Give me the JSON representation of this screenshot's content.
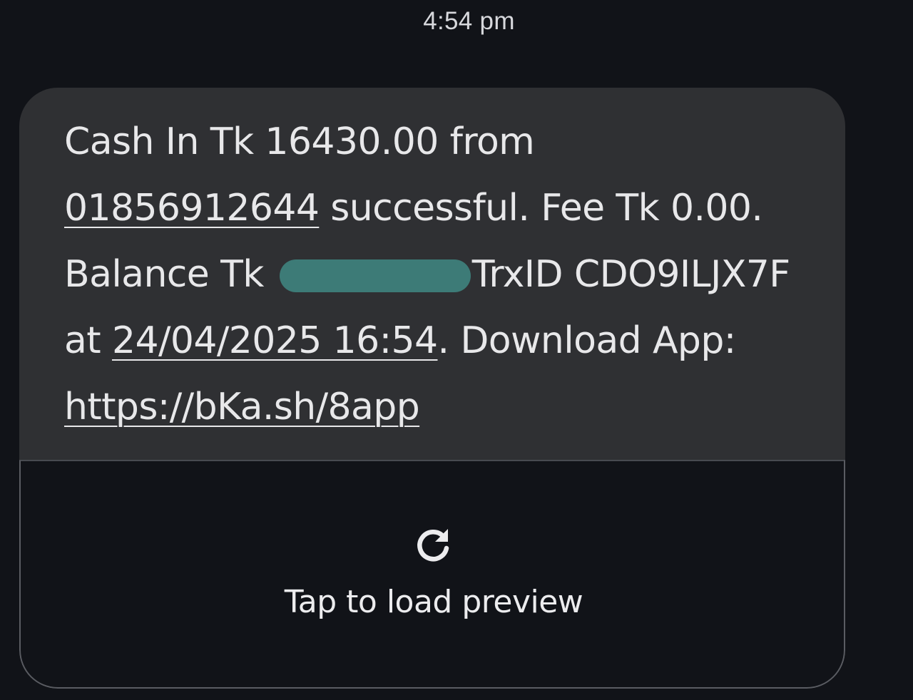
{
  "header": {
    "timestamp": "4:54 pm"
  },
  "message": {
    "line1": "Cash In Tk 16430.00 from",
    "phone_link": "01856912644",
    "line2_rest": " successful. Fee Tk 0.00.",
    "line3_prefix": "Balance Tk ",
    "line3_suffix": "TrxID CDO9ILJX7F",
    "line4_prefix": "at ",
    "datetime_link": "24/04/2025 16:54",
    "line4_suffix": ". Download App:",
    "url_link": "https://bKa.sh/8app"
  },
  "preview": {
    "icon": "reload-icon",
    "label": "Tap to load preview"
  },
  "colors": {
    "background": "#111318",
    "bubble": "#2f3033",
    "redaction": "#3d7b77",
    "text": "#e8e8ea"
  }
}
